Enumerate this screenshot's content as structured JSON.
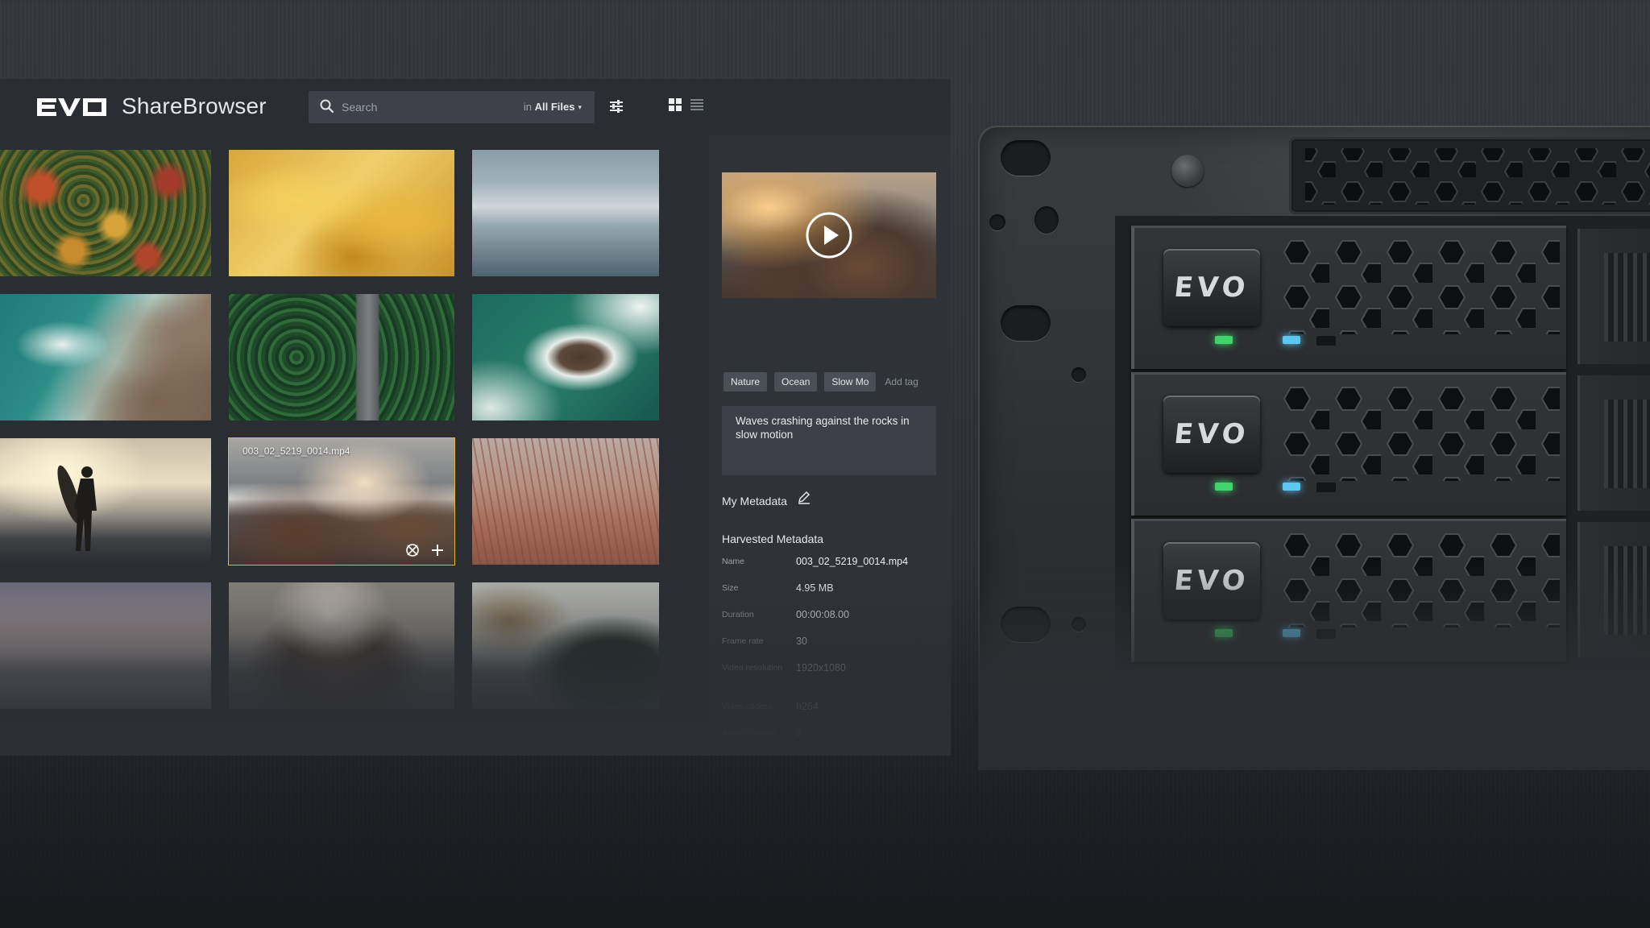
{
  "app": {
    "logo_text": "EVO",
    "name": "ShareBrowser"
  },
  "search": {
    "placeholder": "Search",
    "scope_prefix": "in",
    "scope": "All Files"
  },
  "toolbar": {
    "icons": [
      "filter-sliders-icon",
      "grid-view-icon",
      "list-view-icon"
    ]
  },
  "thumbnails": [
    {
      "scene": "autumn forest aerial"
    },
    {
      "scene": "yellow leaves"
    },
    {
      "scene": "misty sea"
    },
    {
      "scene": "aerial waves on coast"
    },
    {
      "scene": "forest road aerial"
    },
    {
      "scene": "aerial rock in ocean"
    },
    {
      "scene": "surfer at sunset"
    },
    {
      "scene": "waves crashing on rocks",
      "filename": "003_02_5219_0014.mp4",
      "selected": true
    },
    {
      "scene": "wheat field"
    },
    {
      "scene": "snowy beach"
    },
    {
      "scene": "woman in beanie"
    },
    {
      "scene": "foggy forested hills"
    }
  ],
  "detail": {
    "tags": [
      "Nature",
      "Ocean",
      "Slow Mo"
    ],
    "add_tag_label": "Add tag",
    "description": "Waves crashing against the rocks in slow motion",
    "my_metadata_label": "My Metadata",
    "harvested_label": "Harvested Metadata",
    "metadata": [
      {
        "key": "Name",
        "value": "003_02_5219_0014.mp4"
      },
      {
        "key": "Size",
        "value": "4.95 MB"
      },
      {
        "key": "Duration",
        "value": "00:00:08.00"
      },
      {
        "key": "Frame rate",
        "value": "30"
      },
      {
        "key": "Video resolution",
        "value": "1920x1080"
      },
      {
        "key": "Video codecs",
        "value": "h264"
      },
      {
        "key": "Audio channel count",
        "value": "2"
      }
    ]
  },
  "hardware": {
    "badge_text": [
      "EVO",
      "EVO",
      "EVO"
    ]
  },
  "colors": {
    "selection_outline": "#e2b540",
    "led_green": "#41d36b",
    "led_blue": "#5cc8f0"
  }
}
